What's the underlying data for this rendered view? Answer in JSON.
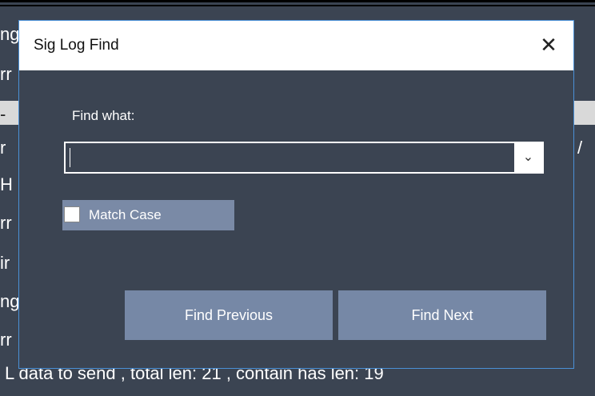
{
  "background": {
    "lines": [
      "ng",
      "rr",
      "-",
      "r",
      "H",
      "rr",
      "ir",
      "ng",
      "rr"
    ],
    "right_fragment": "/",
    "bottom_line": "L data to send , total len: 21 , contain has len: 19"
  },
  "dialog": {
    "title": "Sig Log Find",
    "close_icon": "✕",
    "find_what_label": "Find what:",
    "find_value": "",
    "dropdown_icon": "⌄",
    "match_case_label": "Match Case",
    "match_case_checked": false,
    "find_previous_label": "Find Previous",
    "find_next_label": "Find Next"
  },
  "colors": {
    "dialog_bg": "#3b4452",
    "button_bg": "#7688a6",
    "border_accent": "#4a90d6"
  }
}
